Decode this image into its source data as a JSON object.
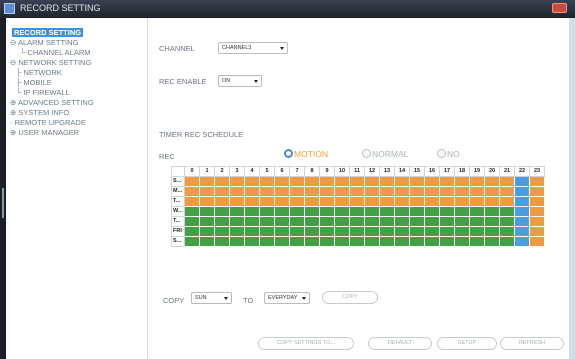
{
  "window": {
    "title": "RECORD SETTING"
  },
  "sidebar": {
    "items": [
      {
        "label": "RECORD SETTING",
        "selected": true
      },
      {
        "label": "ALARM SETTING"
      },
      {
        "label": "CHANNEL ALARM"
      },
      {
        "label": "NETWORK SETTING"
      },
      {
        "label": "NETWORK"
      },
      {
        "label": "MOBILE"
      },
      {
        "label": "IP FIREWALL"
      },
      {
        "label": "ADVANCED SETTING"
      },
      {
        "label": "SYSTEM INFO"
      },
      {
        "label": "REMOTE UPGRADE"
      },
      {
        "label": "USER MANAGER"
      }
    ]
  },
  "form": {
    "channel_label": "CHANNEL",
    "channel_value": "CHANNEL3",
    "rec_enable_label": "REC ENABLE",
    "rec_enable_value": "ON",
    "schedule_title": "TIMER REC SCHEDULE",
    "rec_label": "REC",
    "modes": [
      {
        "label": "MOTION",
        "selected": true
      },
      {
        "label": "NORMAL",
        "selected": false
      },
      {
        "label": "NO",
        "selected": false
      }
    ]
  },
  "schedule": {
    "hours": [
      "0",
      "1",
      "2",
      "3",
      "4",
      "5",
      "6",
      "7",
      "8",
      "9",
      "10",
      "11",
      "12",
      "13",
      "14",
      "15",
      "16",
      "17",
      "18",
      "19",
      "20",
      "21",
      "22",
      "23"
    ],
    "days": [
      "S...",
      "M...",
      "T...",
      "W...",
      "T...",
      "FRI",
      "S..."
    ],
    "colors": {
      "motion": "#ef9a44",
      "normal": "#43a047",
      "none": "#4a9ee0"
    },
    "rows": [
      "MMMMMMMMMMMMMMMMMMMMMMXM",
      "MMMMMMMMMMMMMMMMMMMMMMXM",
      "MMMMMMMMMMMMMMMMMMMMMMXM",
      "NNNNNNNNNNNNNNNNNNNNNNXM",
      "NNNNNNNNNNNNNNNNNNNNNNXM",
      "NNNNNNNNNNNNNNNNNNNNNNXM",
      "NNNNNNNNNNNNNNNNNNNNNNXM"
    ]
  },
  "copy": {
    "copy_label": "COPY",
    "from_value": "SUN",
    "to_label": "TO",
    "to_value": "EVERYDAY",
    "copy_button": "COPY"
  },
  "footer": {
    "copy_settings_button": "COPY SETTINGS TO...",
    "default_button": "DEFAULT",
    "setup_button": "SETUP",
    "refresh_button": "REFRESH"
  }
}
